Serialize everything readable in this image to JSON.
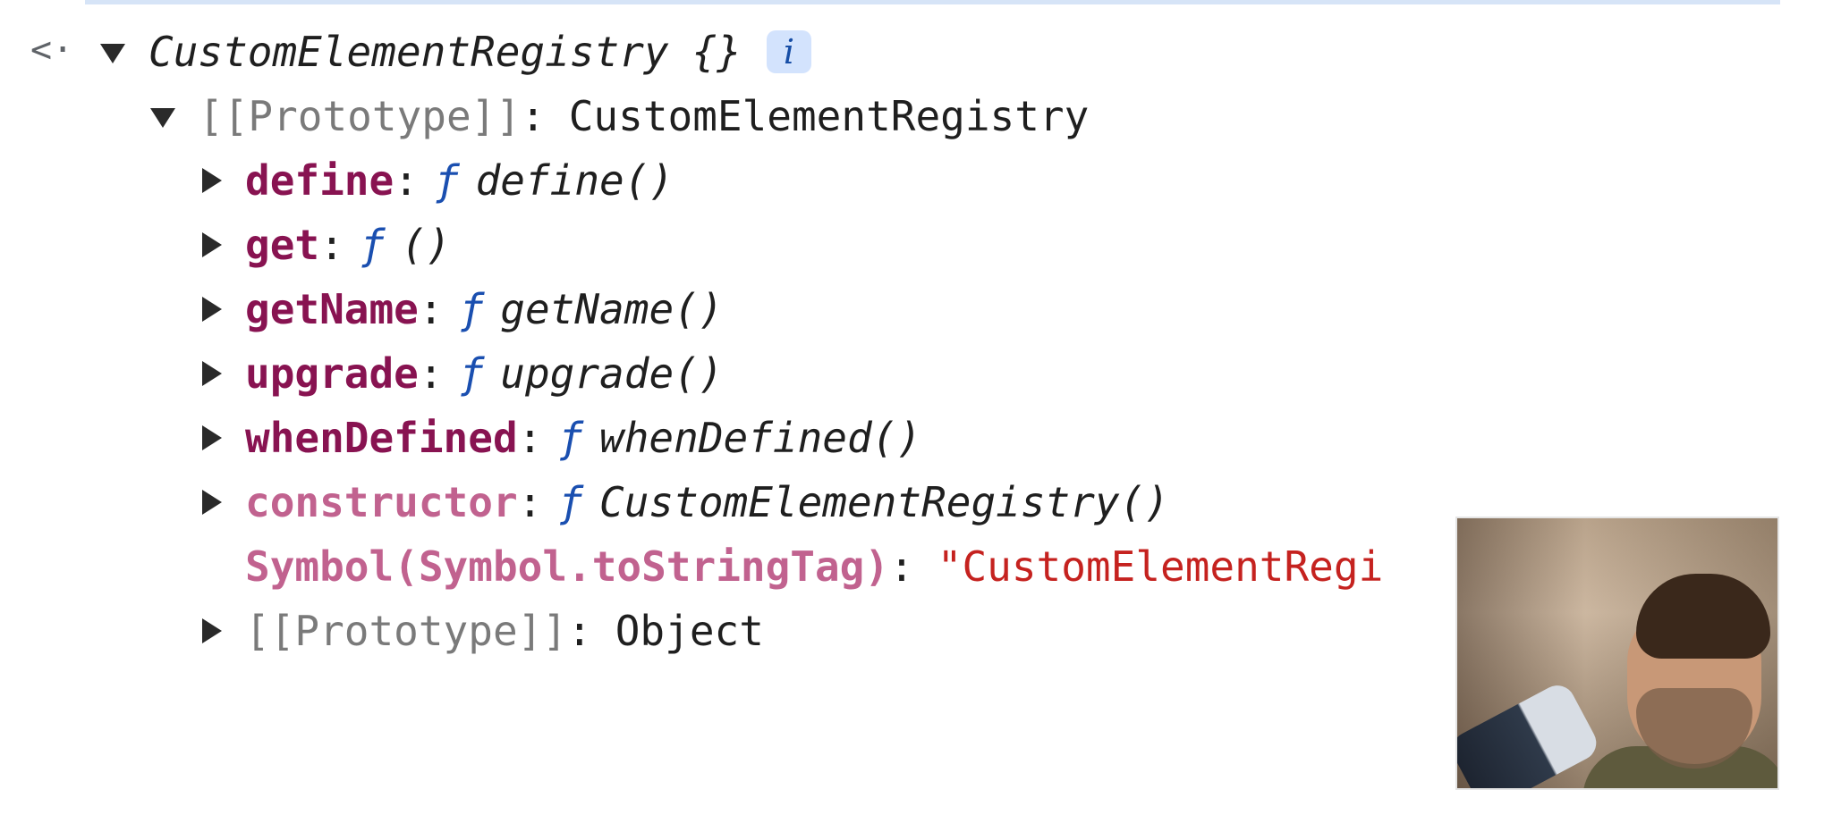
{
  "console": {
    "back_glyph": "<·",
    "root": {
      "name": "CustomElementRegistry",
      "braces": "{}",
      "info_badge": "i"
    },
    "prototype_line": {
      "label": "[[Prototype]]",
      "sep": ":",
      "value": "CustomElementRegistry"
    },
    "entries": [
      {
        "key": "define",
        "sep": ":",
        "fmark": "ƒ",
        "fname": "define()"
      },
      {
        "key": "get",
        "sep": ":",
        "fmark": "ƒ",
        "fname": "()"
      },
      {
        "key": "getName",
        "sep": ":",
        "fmark": "ƒ",
        "fname": "getName()"
      },
      {
        "key": "upgrade",
        "sep": ":",
        "fmark": "ƒ",
        "fname": "upgrade()"
      },
      {
        "key": "whenDefined",
        "sep": ":",
        "fmark": "ƒ",
        "fname": "whenDefined()"
      },
      {
        "key": "constructor",
        "sep": ":",
        "fmark": "ƒ",
        "fname": "CustomElementRegistry()"
      }
    ],
    "symbol_line": {
      "key": "Symbol(Symbol.toStringTag)",
      "sep": ":",
      "value": "\"CustomElementRegi"
    },
    "object_proto_line": {
      "label": "[[Prototype]]",
      "sep": ":",
      "value": "Object"
    }
  },
  "overlay": {
    "type": "webcam-picture-in-picture"
  }
}
